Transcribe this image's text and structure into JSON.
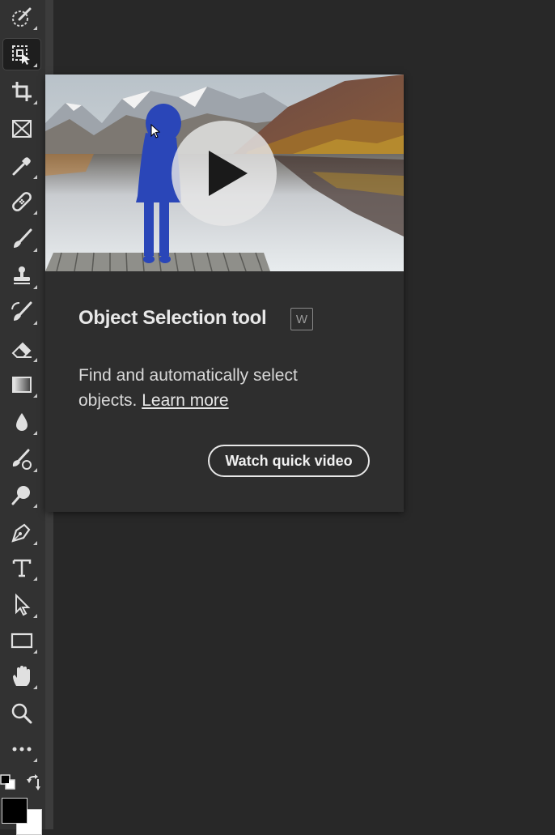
{
  "toolbar": {
    "tools": [
      {
        "name": "Quick Selection",
        "icon": "quick-selection-icon"
      },
      {
        "name": "Object Selection",
        "icon": "object-selection-icon",
        "active": true
      },
      {
        "name": "Crop",
        "icon": "crop-icon"
      },
      {
        "name": "Frame",
        "icon": "frame-icon"
      },
      {
        "name": "Eyedropper",
        "icon": "eyedropper-icon"
      },
      {
        "name": "Spot Healing Brush",
        "icon": "healing-bandage-icon"
      },
      {
        "name": "Brush",
        "icon": "brush-icon"
      },
      {
        "name": "Clone Stamp",
        "icon": "clone-stamp-icon"
      },
      {
        "name": "History Brush",
        "icon": "history-brush-icon"
      },
      {
        "name": "Eraser",
        "icon": "eraser-icon"
      },
      {
        "name": "Gradient",
        "icon": "gradient-icon"
      },
      {
        "name": "Blur",
        "icon": "blur-drop-icon"
      },
      {
        "name": "Smudge",
        "icon": "smudge-icon"
      },
      {
        "name": "Dodge",
        "icon": "dodge-icon"
      },
      {
        "name": "Pen",
        "icon": "pen-icon"
      },
      {
        "name": "Type",
        "icon": "type-icon"
      },
      {
        "name": "Path Selection",
        "icon": "path-selection-arrow-icon"
      },
      {
        "name": "Rectangle",
        "icon": "rectangle-icon"
      },
      {
        "name": "Hand",
        "icon": "hand-icon"
      },
      {
        "name": "Zoom",
        "icon": "zoom-magnifier-icon"
      },
      {
        "name": "Edit Toolbar",
        "icon": "more-ellipsis-icon"
      }
    ],
    "foreground_color": "#000000",
    "background_color": "#ffffff"
  },
  "tooltip": {
    "title": "Object Selection tool",
    "shortcut": "W",
    "description": "Find and automatically select objects.",
    "learn_more": "Learn more",
    "watch_video": "Watch quick video"
  },
  "colors": {
    "panel_bg": "#2e2e2e",
    "toolbar_bg": "#323232",
    "canvas_bg": "#282828",
    "selection_overlay": "#2a46b8"
  }
}
